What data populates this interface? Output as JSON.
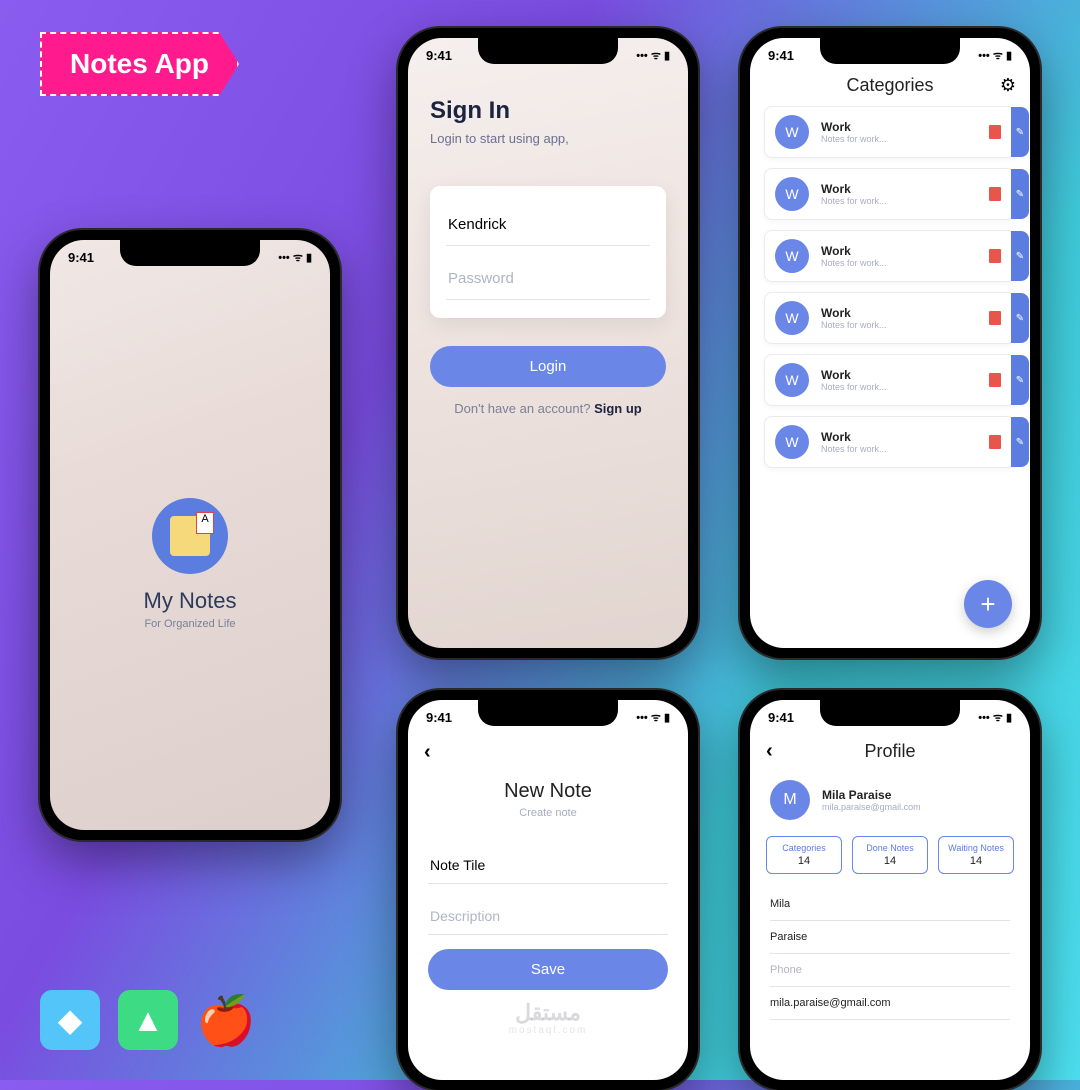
{
  "badge": "Notes App",
  "status": {
    "time": "9:41"
  },
  "splash": {
    "title": "My Notes",
    "subtitle": "For Organized Life"
  },
  "signin": {
    "title": "Sign In",
    "subtitle": "Login to start using app,",
    "username": "Kendrick",
    "password_placeholder": "Password",
    "login": "Login",
    "prompt": "Don't have an account? ",
    "signup": "Sign up"
  },
  "categories": {
    "title": "Categories",
    "item_letter": "W",
    "item_name": "Work",
    "item_sub": "Notes for work..."
  },
  "newnote": {
    "title": "New Note",
    "subtitle": "Create note",
    "note_title": "Note Tile",
    "desc_placeholder": "Description",
    "save": "Save"
  },
  "watermark": {
    "main": "مستقل",
    "sub": "mostaql.com"
  },
  "profile": {
    "title": "Profile",
    "avatar": "M",
    "name": "Mila Paraise",
    "email": "mila.paraise@gmail.com",
    "stats": [
      {
        "label": "Categories",
        "value": "14"
      },
      {
        "label": "Done Notes",
        "value": "14"
      },
      {
        "label": "Waiting Notes",
        "value": "14"
      }
    ],
    "fields": {
      "first": "Mila",
      "last": "Paraise",
      "phone": "Phone",
      "email": "mila.paraise@gmail.com"
    }
  }
}
